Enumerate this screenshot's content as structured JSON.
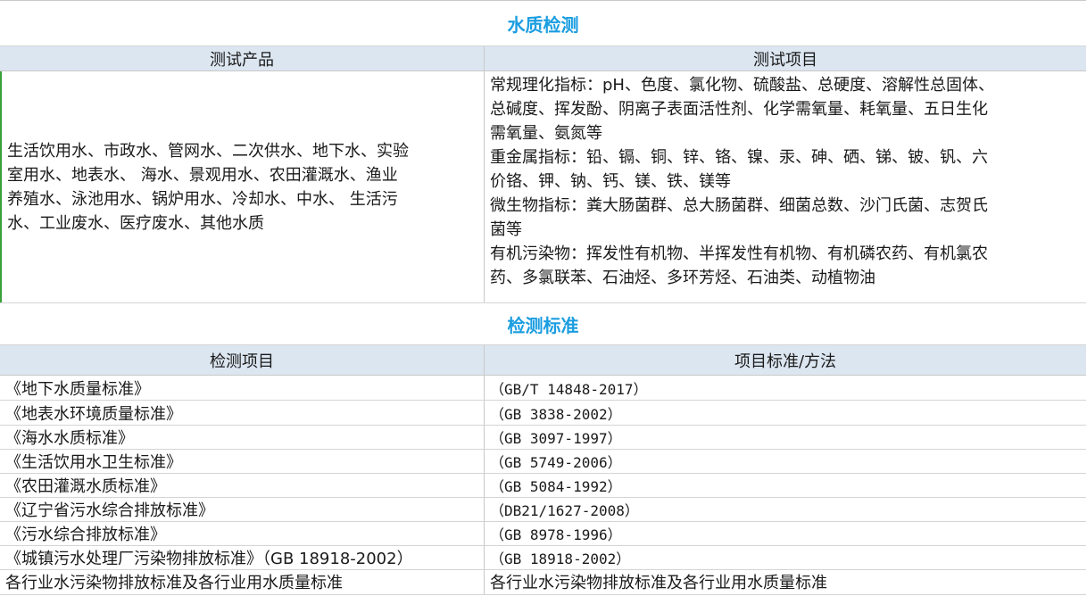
{
  "water_test": {
    "title": "水质检测",
    "headers": [
      "测试产品",
      "测试项目"
    ],
    "products": [
      "生活饮用水、市政水、管网水、二次供水、地下水、实验",
      "室用水、地表水、  海水、景观用水、农田灌溉水、渔业",
      "养殖水、泳池用水、锅炉用水、冷却水、中水、  生活污",
      "水、工业废水、医疗废水、其他水质"
    ],
    "items": [
      "常规理化指标：pH、色度、氯化物、硫酸盐、总硬度、溶解性总固体、",
      "总碱度、挥发酚、阴离子表面活性剂、化学需氧量、耗氧量、五日生化",
      "需氧量、氨氮等",
      "重金属指标：铅、镉、铜、锌、铬、镍、汞、砷、硒、锑、铍、钒、六",
      "价铬、钾、钠、钙、镁、铁、镁等",
      "微生物指标：粪大肠菌群、总大肠菌群、细菌总数、沙门氏菌、志贺氏",
      "菌等",
      "有机污染物：挥发性有机物、半挥发性有机物、有机磷农药、有机氯农",
      "药、多氯联苯、石油烃、多环芳烃、石油类、动植物油"
    ]
  },
  "standards": {
    "title": "检测标准",
    "headers": [
      "检测项目",
      "项目标准/方法"
    ],
    "rows": [
      {
        "name": "《地下水质量标准》",
        "code": "（GB/T 14848-2017）"
      },
      {
        "name": "《地表水环境质量标准》",
        "code": "（GB 3838-2002）"
      },
      {
        "name": "《海水水质标准》",
        "code": "（GB 3097-1997）"
      },
      {
        "name": "《生活饮用水卫生标准》",
        "code": "（GB 5749-2006）"
      },
      {
        "name": "《农田灌溉水质标准》",
        "code": "（GB 5084-1992）"
      },
      {
        "name": "《辽宁省污水综合排放标准》",
        "code": "（DB21/1627-2008）"
      },
      {
        "name": "《污水综合排放标准》",
        "code": "（GB 8978-1996）"
      },
      {
        "name": "《城镇污水处理厂污染物排放标准》（GB 18918-2002）",
        "code": "（GB 18918-2002）"
      },
      {
        "name": "各行业水污染物排放标准及各行业用水质量标准",
        "code": "各行业水污染物排放标准及各行业用水质量标准"
      }
    ]
  }
}
